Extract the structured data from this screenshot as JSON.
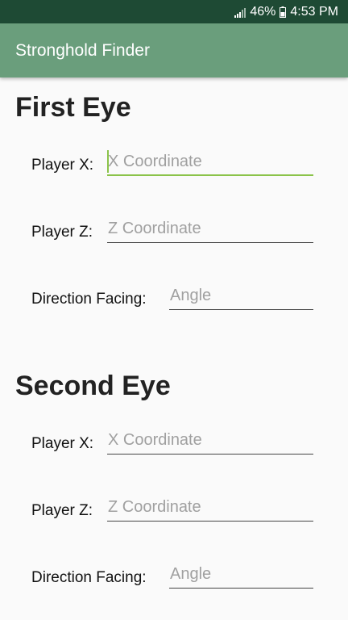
{
  "status_bar": {
    "battery_percent": "46%",
    "time": "4:53 PM",
    "icons": [
      "signal-icon",
      "battery-icon"
    ]
  },
  "app_bar": {
    "title": "Stronghold Finder"
  },
  "colors": {
    "status_bar": "#1e4a34",
    "app_bar": "#6a9e7c",
    "focus_underline": "#8bc34a",
    "background": "#fafafa"
  },
  "sections": [
    {
      "title": "First Eye",
      "fields": [
        {
          "label": "Player X:",
          "placeholder": "X Coordinate",
          "value": ""
        },
        {
          "label": "Player Z:",
          "placeholder": "Z Coordinate",
          "value": ""
        },
        {
          "label": "Direction Facing:",
          "placeholder": "Angle",
          "value": ""
        }
      ]
    },
    {
      "title": "Second Eye",
      "fields": [
        {
          "label": "Player X:",
          "placeholder": "X Coordinate",
          "value": ""
        },
        {
          "label": "Player Z:",
          "placeholder": "Z Coordinate",
          "value": ""
        },
        {
          "label": "Direction Facing:",
          "placeholder": "Angle",
          "value": ""
        }
      ]
    }
  ]
}
